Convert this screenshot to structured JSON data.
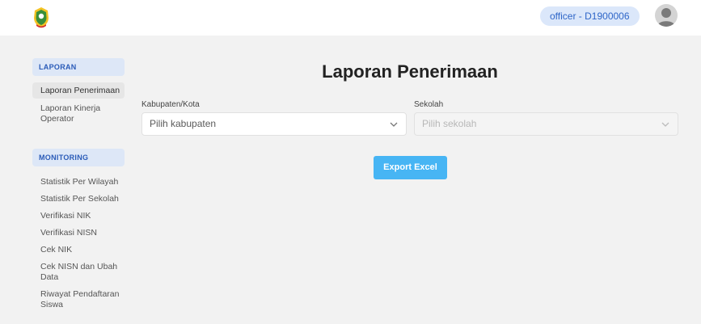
{
  "header": {
    "user_badge": "officer - D1900006"
  },
  "sidebar": {
    "sections": [
      {
        "title": "LAPORAN",
        "items": [
          "Laporan Penerimaan",
          "Laporan Kinerja Operator"
        ]
      },
      {
        "title": "MONITORING",
        "items": [
          "Statistik Per Wilayah",
          "Statistik Per Sekolah",
          "Verifikasi NIK",
          "Verifikasi NISN",
          "Cek NIK",
          "Cek NISN dan Ubah Data",
          "Riwayat Pendaftaran Siswa"
        ]
      }
    ],
    "active_item": "Laporan Penerimaan"
  },
  "main": {
    "title": "Laporan Penerimaan",
    "kabupaten": {
      "label": "Kabupaten/Kota",
      "placeholder": "Pilih kabupaten"
    },
    "sekolah": {
      "label": "Sekolah",
      "placeholder": "Pilih sekolah",
      "disabled": true
    },
    "export_label": "Export Excel"
  },
  "colors": {
    "accent": "#47b5f4",
    "badge_bg": "#dbe7fa",
    "badge_text": "#2f66c8",
    "section_bg": "#dde7f7"
  },
  "icons": [
    "logo-emblem",
    "user-avatar-icon",
    "chevron-down-icon"
  ]
}
